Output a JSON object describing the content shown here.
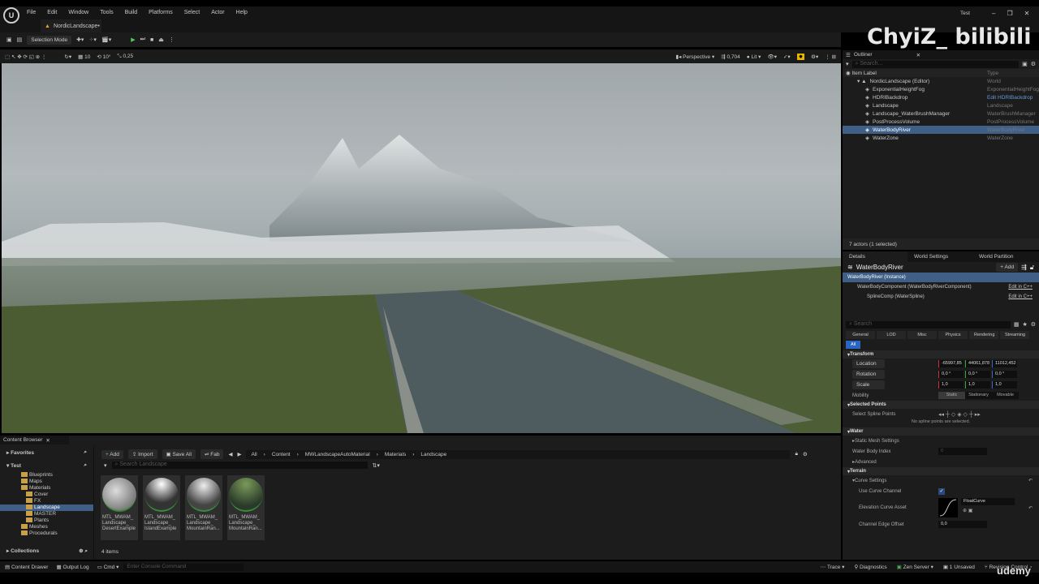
{
  "menu": [
    "File",
    "Edit",
    "Window",
    "Tools",
    "Build",
    "Platforms",
    "Select",
    "Actor",
    "Help"
  ],
  "window_title": "Test",
  "doc_tab": "NordicLandscape•",
  "toolbar": {
    "mode": "Selection Mode"
  },
  "viewport_toolbar": {
    "snap_translate": "10",
    "snap_rotate": "10°",
    "snap_scale": "0,25",
    "view": "Perspective",
    "camera_speed": "0,704",
    "lit": "Lit"
  },
  "watermark": "ChyiZ_ bilibili",
  "outliner": {
    "title": "Outliner",
    "search_placeholder": "Search...",
    "col_label": "Item Label",
    "col_type": "Type",
    "items": [
      {
        "label": "NordicLandscape (Editor)",
        "type": "World"
      },
      {
        "label": "ExponentialHeightFog",
        "type": "ExponentialHeightFog"
      },
      {
        "label": "HDRIBackdrop",
        "type": "Edit HDRIBackdrop"
      },
      {
        "label": "Landscape",
        "type": "Landscape"
      },
      {
        "label": "Landscape_WaterBrushManager",
        "type": "WaterBrushManager"
      },
      {
        "label": "PostProcessVolume",
        "type": "PostProcessVolume"
      },
      {
        "label": "WaterBodyRiver",
        "type": "WaterBodyRiver"
      },
      {
        "label": "WaterZone",
        "type": "WaterZone"
      }
    ],
    "footer": "7 actors (1 selected)"
  },
  "details": {
    "tabs": [
      "Details",
      "World Settings",
      "World Partition"
    ],
    "actor": "WaterBodyRiver",
    "add": "Add",
    "components": [
      {
        "label": "WaterBodyRiver (Instance)",
        "edit": ""
      },
      {
        "label": "WaterBodyComponent (WaterBodyRiverComponent)",
        "edit": "Edit in C++"
      },
      {
        "label": "SplineComp (WaterSpline)",
        "edit": "Edit in C++"
      }
    ],
    "search_placeholder": "Search",
    "filters": [
      "General",
      "LOD",
      "Misc",
      "Physics",
      "Rendering",
      "Streaming",
      "All"
    ],
    "transform": {
      "title": "Transform",
      "location_label": "Location",
      "location": [
        "-65997,85",
        "44061,878",
        "11012,452"
      ],
      "rotation_label": "Rotation",
      "rotation": [
        "0,0 °",
        "0,0 °",
        "0,0 °"
      ],
      "scale_label": "Scale",
      "scale": [
        "1,0",
        "1,0",
        "1,0"
      ],
      "mobility_label": "Mobility",
      "mobility": [
        "Static",
        "Stationary",
        "Movable"
      ]
    },
    "selected_points": {
      "title": "Selected Points",
      "label": "Select Spline Points",
      "empty": "No spline points are selected."
    },
    "water": {
      "title": "Water",
      "static_mesh": "Static Mesh Settings",
      "index_label": "Water Body Index",
      "index": "0",
      "advanced": "Advanced"
    },
    "terrain": {
      "title": "Terrain",
      "curve_settings": "Curve Settings",
      "use_curve": "Use Curve Channel",
      "use_curve_checked": true,
      "curve_asset_label": "Elevation Curve Asset",
      "curve_asset": "FloatCurve",
      "edge_offset_label": "Channel Edge Offset",
      "edge_offset": "0,0"
    }
  },
  "content_browser": {
    "title": "Content Browser",
    "favorites": "Favorites",
    "project": "Test",
    "collections": "Collections",
    "folders": [
      "Blueprints",
      "Maps",
      "Materials",
      "Cover",
      "FX",
      "Landscape",
      "MASTER",
      "Plants",
      "Meshes",
      "Procedurals"
    ],
    "buttons": {
      "add": "Add",
      "import": "Import",
      "save_all": "Save All",
      "fab": "Fab"
    },
    "path": [
      "All",
      "Content",
      "MWLandscapeAutoMaterial",
      "Materials",
      "Landscape"
    ],
    "search_placeholder": "Search Landscape",
    "assets": [
      "MTL_MWAM_ Landscape_ DesertExample",
      "MTL_MWAM_ Landscape_ IslandExample",
      "MTL_MWAM_ Landscape_ MountainRan...",
      "MTL_MWAM_ Landscape_ MountainRan..."
    ],
    "count": "4 items"
  },
  "status": {
    "content_drawer": "Content Drawer",
    "output_log": "Output Log",
    "cmd": "Cmd",
    "console_placeholder": "Enter Console Command",
    "trace": "Trace",
    "diagnostics": "Diagnostics",
    "zen": "Zen Server",
    "unsaved": "1 Unsaved",
    "revision": "Revision Control"
  },
  "udemy": "udemy"
}
